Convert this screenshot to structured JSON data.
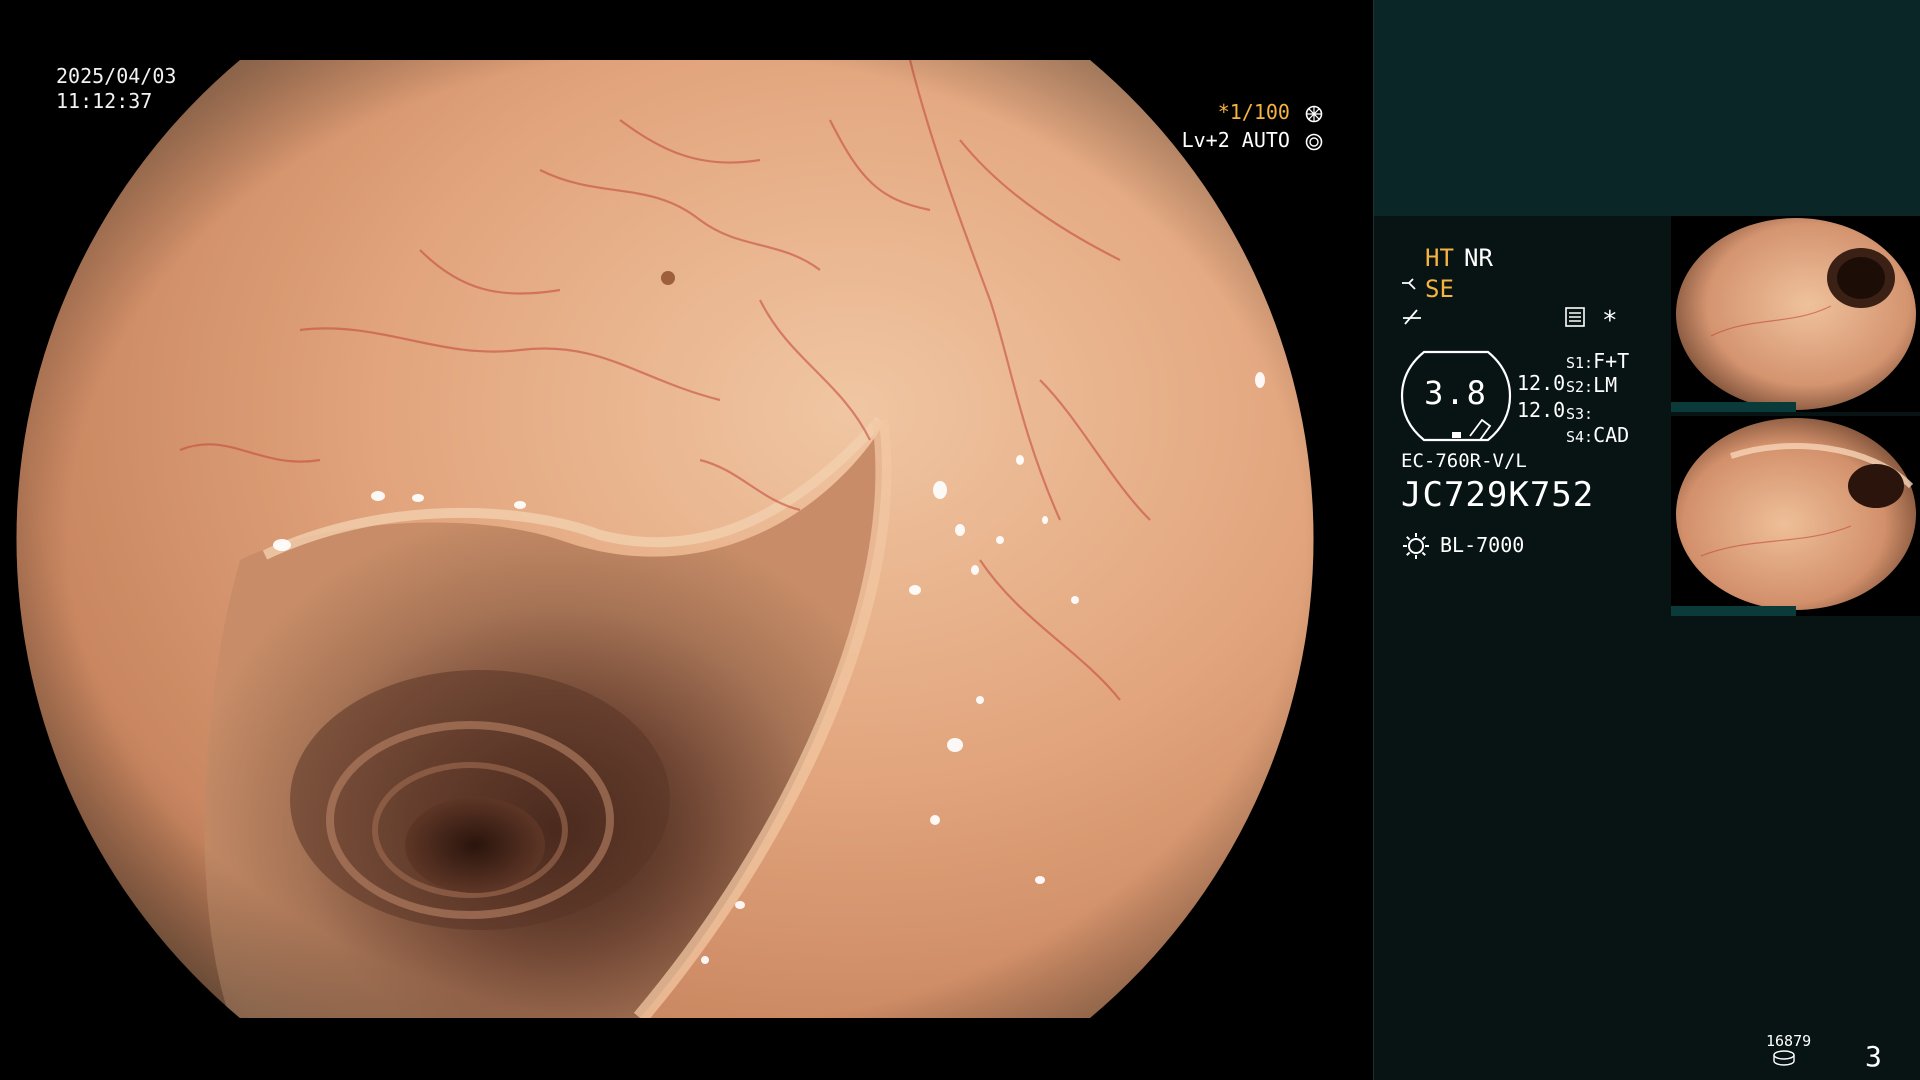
{
  "overlay": {
    "date": "2025/04/03",
    "time": "11:12:37",
    "shutter_mark": "*1/100",
    "shutter_icon": "aperture-icon",
    "level_auto": "Lv+2 AUTO",
    "auto_icon": "ring-icon"
  },
  "panel": {
    "modes": {
      "ht": "HT",
      "nr": "NR",
      "se": "SE"
    },
    "icons": [
      "structure-enhance-icon",
      "freeze-icon",
      "settings-list-icon",
      "star-icon"
    ],
    "star": "*",
    "zoom": "3.8",
    "gain": [
      "12.0",
      "12.0"
    ],
    "switches": [
      {
        "key": "S1:",
        "value": "F+T"
      },
      {
        "key": "S2:",
        "value": "LM"
      },
      {
        "key": "S3:",
        "value": ""
      },
      {
        "key": "S4:",
        "value": "CAD"
      }
    ],
    "scope_model": "EC-760R-V/L",
    "scope_serial": "JC729K752",
    "light_source": "BL-7000",
    "counter": "16879",
    "page": "3"
  },
  "colors": {
    "accent": "#f5b441",
    "panel_bg": "#081414",
    "panel_band": "#0a2626",
    "tissue": "#e3a77f",
    "vessel": "#c2443a"
  }
}
